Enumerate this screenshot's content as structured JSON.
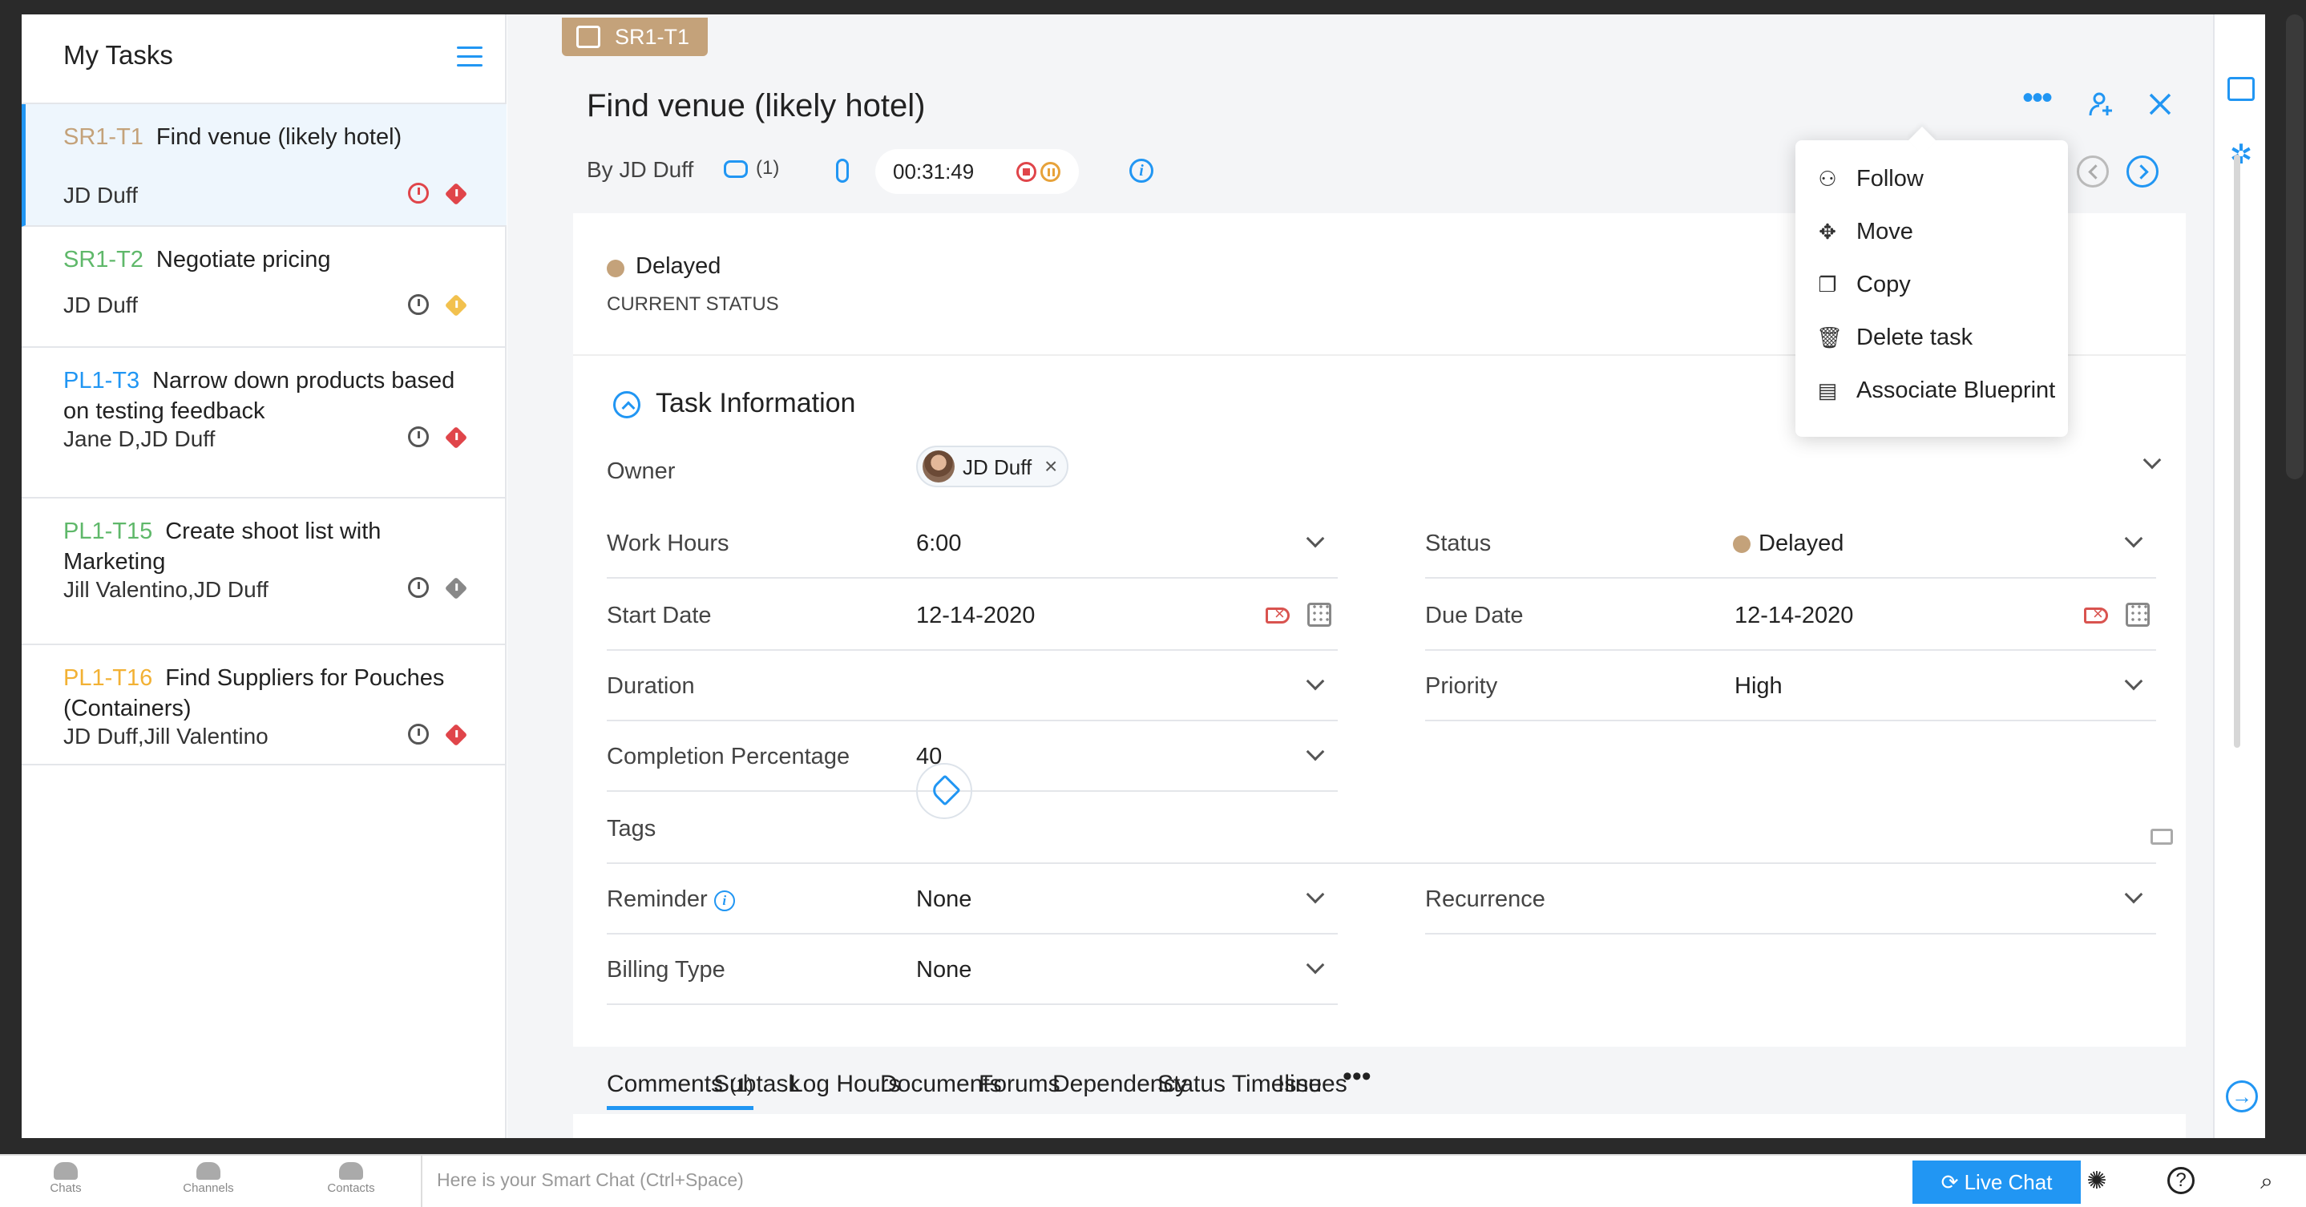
{
  "left_panel": {
    "title": "My Tasks",
    "tasks": [
      {
        "code": "SR1-T1",
        "code_color": "#c4a27a",
        "title": "Find venue (likely hotel)",
        "assignees": "JD Duff",
        "priority_color": "#e0454a",
        "active": true
      },
      {
        "code": "SR1-T2",
        "code_color": "#5fb86a",
        "title": "Negotiate pricing",
        "assignees": "JD Duff",
        "priority_color": "#f2c14e"
      },
      {
        "code": "PL1-T3",
        "code_color": "#2196f3",
        "title": "Narrow down products based on testing feedback",
        "assignees": "Jane D,JD Duff",
        "priority_color": "#e0454a"
      },
      {
        "code": "PL1-T15",
        "code_color": "#5fb86a",
        "title": "Create shoot list with Marketing",
        "assignees": "Jill Valentino,JD Duff",
        "priority_color": "#888888"
      },
      {
        "code": "PL1-T16",
        "code_color": "#f2b134",
        "title": "Find Suppliers for Pouches (Containers)",
        "assignees": "JD Duff,Jill Valentino",
        "priority_color": "#e0454a"
      }
    ]
  },
  "detail": {
    "code": "SR1-T1",
    "title": "Find venue (likely hotel)",
    "by": "By JD Duff",
    "comment_count": "(1)",
    "timer": "00:31:49",
    "current_status": "Delayed",
    "current_status_label": "CURRENT STATUS",
    "status_color": "#c4a27a",
    "section_title": "Task Information",
    "fields": {
      "owner_label": "Owner",
      "owner": "JD Duff",
      "work_hours_label": "Work Hours",
      "work_hours": "6:00",
      "status_label": "Status",
      "status": "Delayed",
      "start_date_label": "Start Date",
      "start_date": "12-14-2020",
      "due_date_label": "Due Date",
      "due_date": "12-14-2020",
      "duration_label": "Duration",
      "priority_label": "Priority",
      "priority": "High",
      "completion_label": "Completion Percentage",
      "completion": "40",
      "tags_label": "Tags",
      "reminder_label": "Reminder",
      "reminder": "None",
      "recurrence_label": "Recurrence",
      "billing_label": "Billing Type",
      "billing": "None"
    },
    "tabs": [
      "Comments",
      "Subtask",
      "Log Hours",
      "Documents",
      "Forums",
      "Dependency",
      "Status Timeline",
      "Issues"
    ],
    "comments_count": "(1)"
  },
  "menu": {
    "items": [
      {
        "icon": "follow-icon",
        "label": "Follow"
      },
      {
        "icon": "move-icon",
        "label": "Move"
      },
      {
        "icon": "copy-icon",
        "label": "Copy"
      },
      {
        "icon": "trash-icon",
        "label": "Delete task"
      },
      {
        "icon": "blueprint-icon",
        "label": "Associate Blueprint"
      }
    ]
  },
  "bottom_bar": {
    "chats": "Chats",
    "channels": "Channels",
    "contacts": "Contacts",
    "smart_chat_placeholder": "Here is your Smart Chat (Ctrl+Space)",
    "live_chat": "Live Chat"
  },
  "accent_color": "#2196f3"
}
